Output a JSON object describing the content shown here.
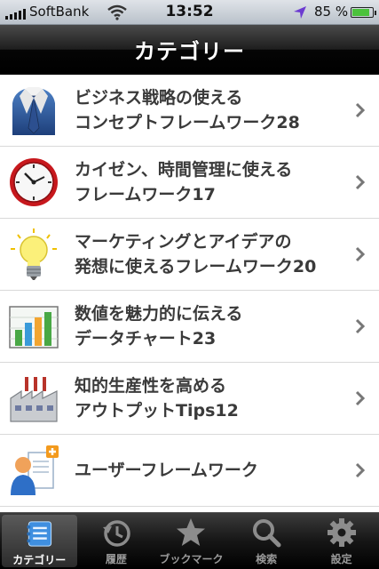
{
  "status_bar": {
    "carrier": "SoftBank",
    "time": "13:52",
    "battery_percent": "85 %",
    "battery_level": 0.85
  },
  "nav": {
    "title": "カテゴリー"
  },
  "list": [
    {
      "line1": "ビジネス戦略の使える",
      "line2": "コンセプトフレームワーク28",
      "icon": "suit-tie-icon"
    },
    {
      "line1": "カイゼン、時間管理に使える",
      "line2": "フレームワーク17",
      "icon": "clock-icon"
    },
    {
      "line1": "マーケティングとアイデアの",
      "line2": "発想に使えるフレームワーク20",
      "icon": "lightbulb-icon"
    },
    {
      "line1": "数値を魅力的に伝える",
      "line2": "データチャート23",
      "icon": "bar-chart-icon"
    },
    {
      "line1": "知的生産性を高める",
      "line2": "アウトプットTips12",
      "icon": "factory-icon"
    },
    {
      "line1": "ユーザーフレームワーク",
      "line2": "",
      "icon": "user-add-icon"
    }
  ],
  "tabs": [
    {
      "label": "カテゴリー",
      "icon": "category-list-icon",
      "active": true
    },
    {
      "label": "履歴",
      "icon": "history-icon",
      "active": false
    },
    {
      "label": "ブックマーク",
      "icon": "star-icon",
      "active": false
    },
    {
      "label": "検索",
      "icon": "search-icon",
      "active": false
    },
    {
      "label": "設定",
      "icon": "gear-icon",
      "active": false
    }
  ]
}
